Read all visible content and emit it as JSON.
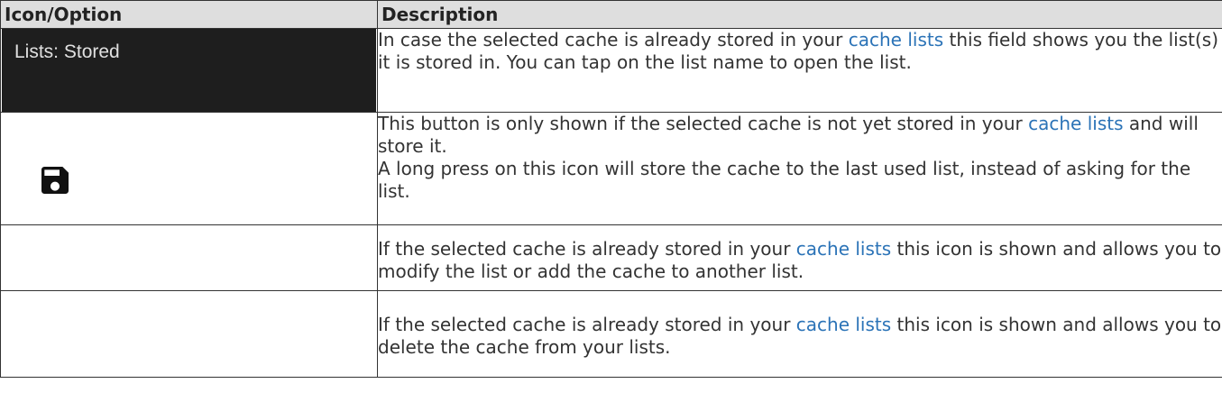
{
  "table": {
    "headers": [
      "Icon/Option",
      "Description"
    ],
    "rows": [
      {
        "icon_text": "Lists: Stored",
        "desc_parts": [
          "In case the selected cache is already stored in your ",
          "cache lists",
          " this field shows you the list(s) it is stored in. You can tap on the list name to open the list."
        ]
      },
      {
        "icon": "save-floppy-icon",
        "desc_parts": [
          "This button is only shown if the selected cache is not yet stored in your ",
          "cache lists",
          " and will store it.",
          "A long press on this icon will store the cache to the last used list, instead of asking for the list."
        ]
      },
      {
        "desc_parts": [
          "If the selected cache is already stored in your ",
          "cache lists",
          " this icon is shown and allows you to modify the list or add the cache to another list."
        ]
      },
      {
        "desc_parts": [
          "If the selected cache is already stored in your ",
          "cache lists",
          " this icon is shown and allows you to delete the cache from your lists."
        ]
      }
    ]
  },
  "colors": {
    "header_bg": "#dedede",
    "border": "#333333",
    "link": "#2b73b7",
    "dark_chip_bg": "#1e1e1e"
  }
}
